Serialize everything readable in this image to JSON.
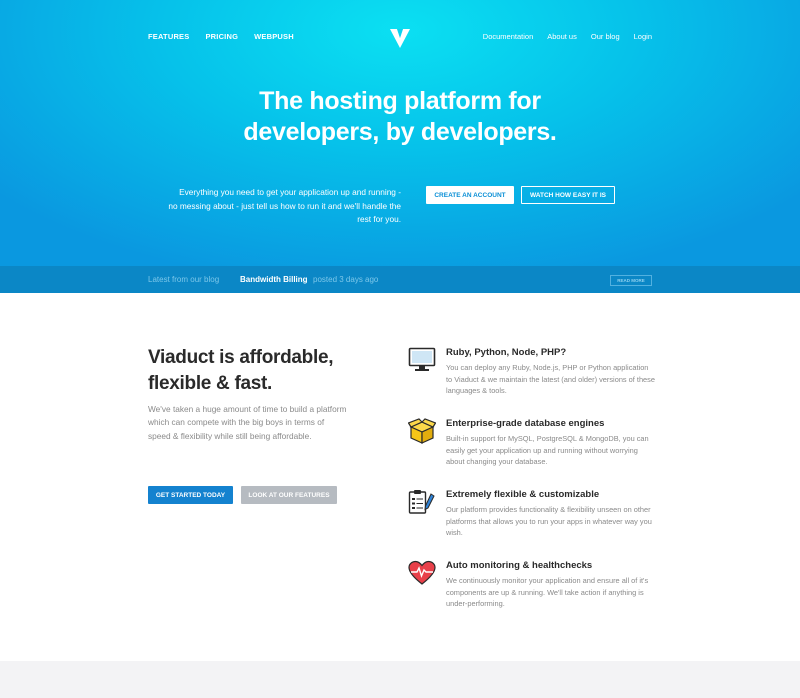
{
  "nav": {
    "left": [
      "FEATURES",
      "PRICING",
      "WEBPUSH"
    ],
    "right": [
      "Documentation",
      "About us",
      "Our blog",
      "Login"
    ]
  },
  "hero": {
    "headline_line1": "The hosting platform for",
    "headline_line2": "developers, by developers.",
    "text": "Everything you need to get your application up and running - no messing about - just tell us how to run it and we'll handle the rest for you.",
    "primary_button": "CREATE AN ACCOUNT",
    "secondary_button": "WATCH HOW EASY IT IS"
  },
  "blog": {
    "label": "Latest from our blog",
    "title": "Bandwidth Billing",
    "posted": "posted 3 days ago",
    "read_more": "READ MORE"
  },
  "pitch": {
    "title_line1": "Viaduct is affordable,",
    "title_line2": "flexible & fast.",
    "text": "We've taken a huge amount of time to build a platform which can compete with the big boys in terms of speed & flexibility while still being affordable.",
    "start_button": "GET STARTED TODAY",
    "features_button": "LOOK AT OUR FEATURES"
  },
  "features": [
    {
      "icon": "monitor-icon",
      "title": "Ruby, Python, Node, PHP?",
      "text": "You can deploy any Ruby, Node.js, PHP or Python application to Viaduct & we maintain the latest (and older) versions of these languages & tools."
    },
    {
      "icon": "box-icon",
      "title": "Enterprise-grade database engines",
      "text": "Built-in support for MySQL, PostgreSQL & MongoDB, you can easily get your application up and running without worrying about changing your database."
    },
    {
      "icon": "clipboard-icon",
      "title": "Extremely flexible & customizable",
      "text": "Our platform provides functionality & flexibility unseen on other platforms that allows you to run your apps in whatever way you wish."
    },
    {
      "icon": "heart-pulse-icon",
      "title": "Auto monitoring & healthchecks",
      "text": "We continuously monitor your application and ensure all of it's components are up & running. We'll take action if anything is under-performing."
    }
  ],
  "colors": {
    "accent": "#1482cf",
    "blog_bar": "#0b87c6",
    "hero_light": "#0be0f2",
    "hero_dark": "#0a98e0",
    "icon_yellow": "#f5c518",
    "icon_red": "#e8404a"
  }
}
